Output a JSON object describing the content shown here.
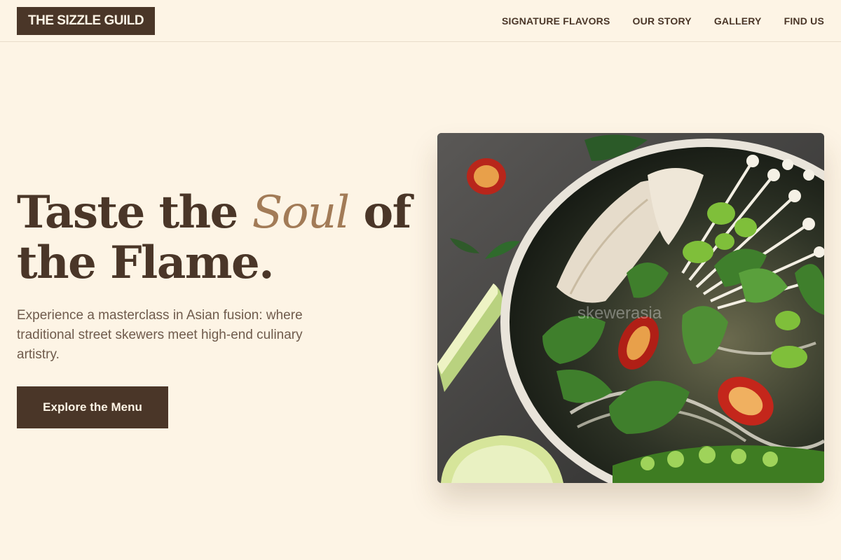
{
  "header": {
    "logo": "THE SIZZLE GUILD",
    "nav": [
      "SIGNATURE FLAVORS",
      "OUR STORY",
      "GALLERY",
      "FIND US"
    ]
  },
  "hero": {
    "title_part1": "Taste the ",
    "title_accent": "Soul",
    "title_part2": " of the Flame.",
    "subtitle": "Experience a masterclass in Asian fusion: where traditional street skewers meet high-end culinary artistry.",
    "cta_label": "Explore the Menu"
  },
  "image": {
    "alt": "Bowl of noodle soup with herbs, chili, edamame and lime",
    "watermark": "skewerasia"
  },
  "colors": {
    "background": "#fdf4e5",
    "brand_dark": "#4a3628",
    "accent": "#a27b57"
  }
}
